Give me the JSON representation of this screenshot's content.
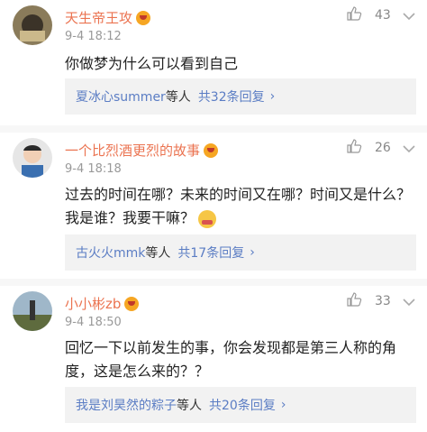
{
  "comments": [
    {
      "user": "天生帝王攻",
      "time": "9-4 18:12",
      "likes": "43",
      "text": "你做梦为什么可以看到自己",
      "reply_users": "夏冰心summer",
      "reply_suffix": "等人",
      "reply_count": "共32条回复",
      "chevron": "›"
    },
    {
      "user": "一个比烈酒更烈的故事",
      "time": "9-4 18:18",
      "likes": "26",
      "text": "过去的时间在哪？未来的时间又在哪？时间又是什么？我是谁？我要干嘛？",
      "reply_users": "古火火mmk",
      "reply_suffix": "等人",
      "reply_count": "共17条回复",
      "chevron": "›"
    },
    {
      "user": "小小彬zb",
      "time": "9-4 18:50",
      "likes": "33",
      "text": "回忆一下以前发生的事，你会发现都是第三人称的角度，这是怎么来的？？",
      "reply_users": "我是刘昊然的粽子",
      "reply_suffix": "等人",
      "reply_count": "共20条回复",
      "chevron": "›"
    }
  ],
  "icons": {
    "like": "thumbs-up-icon",
    "more": "chevron-down-icon",
    "vip": "vip-badge-icon",
    "emoji": "laughing-emoji-icon"
  },
  "colors": {
    "username": "#eb7350",
    "link": "#5b7dc4",
    "reply_bg": "#f2f2f2"
  }
}
